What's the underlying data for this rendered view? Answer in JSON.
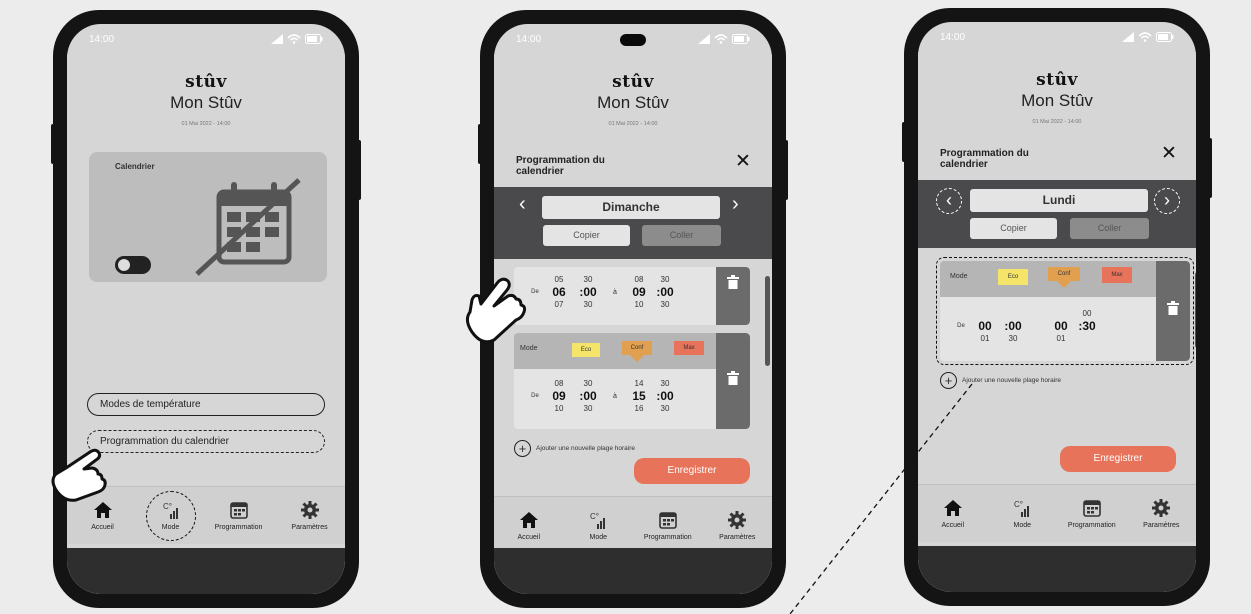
{
  "phones": [
    {
      "status_time": "14:00",
      "logo": "stûv",
      "title": "Mon Stûv",
      "date_text": "01 Mai 2022  -  14:00",
      "calendar_card_label": "Calendrier",
      "menu": [
        "Modes de température",
        "Programmation du calendrier"
      ],
      "nav": [
        "Accueil",
        "Mode",
        "Programmation",
        "Paramètres"
      ]
    },
    {
      "status_time": "14:00",
      "logo": "stûv",
      "title": "Mon Stûv",
      "date_text": "01 Mai 2022  -  14:00",
      "panel_title": "Programmation du calendrier",
      "day": "Dimanche",
      "copy": "Copier",
      "paste": "Coller",
      "slot1": {
        "prefix": "De",
        "sep": "à",
        "start_h": [
          "05",
          "06",
          "07"
        ],
        "start_m": [
          "30",
          "00",
          "30"
        ],
        "end_h": [
          "08",
          "09",
          "10"
        ],
        "end_m": [
          "30",
          "00",
          "30"
        ]
      },
      "slot2": {
        "mode_label": "Mode",
        "modes": [
          "Eco",
          "Conf",
          "Max"
        ],
        "prefix": "De",
        "sep": "à",
        "start_h": [
          "08",
          "09",
          "10"
        ],
        "start_m": [
          "30",
          "00",
          "30"
        ],
        "end_h": [
          "14",
          "15",
          "16"
        ],
        "end_m": [
          "30",
          "00",
          "30"
        ]
      },
      "add_slot": "Ajouter une nouvelle plage horaire",
      "save": "Enregistrer",
      "nav": [
        "Accueil",
        "Mode",
        "Programmation",
        "Paramètres"
      ]
    },
    {
      "status_time": "14:00",
      "logo": "stûv",
      "title": "Mon Stûv",
      "date_text": "01 Mai 2022  -  14:00",
      "panel_title": "Programmation du calendrier",
      "day": "Lundi",
      "copy": "Copier",
      "paste": "Coller",
      "slot1": {
        "mode_label": "Mode",
        "modes": [
          "Eco",
          "Conf",
          "Max"
        ],
        "prefix": "De",
        "start_h": [
          "",
          "00",
          "01"
        ],
        "start_m": [
          "",
          "00",
          "30"
        ],
        "end_h": [
          "",
          "00",
          "01"
        ],
        "end_m": [
          "00",
          "30",
          ""
        ]
      },
      "add_slot": "Ajouter une nouvelle plage horaire",
      "save": "Enregistrer",
      "nav": [
        "Accueil",
        "Mode",
        "Programmation",
        "Paramètres"
      ]
    }
  ],
  "colors": {
    "save": "#e8735b",
    "eco": "#f4e46a",
    "conf": "#e0a050",
    "max": "#e8735b"
  }
}
